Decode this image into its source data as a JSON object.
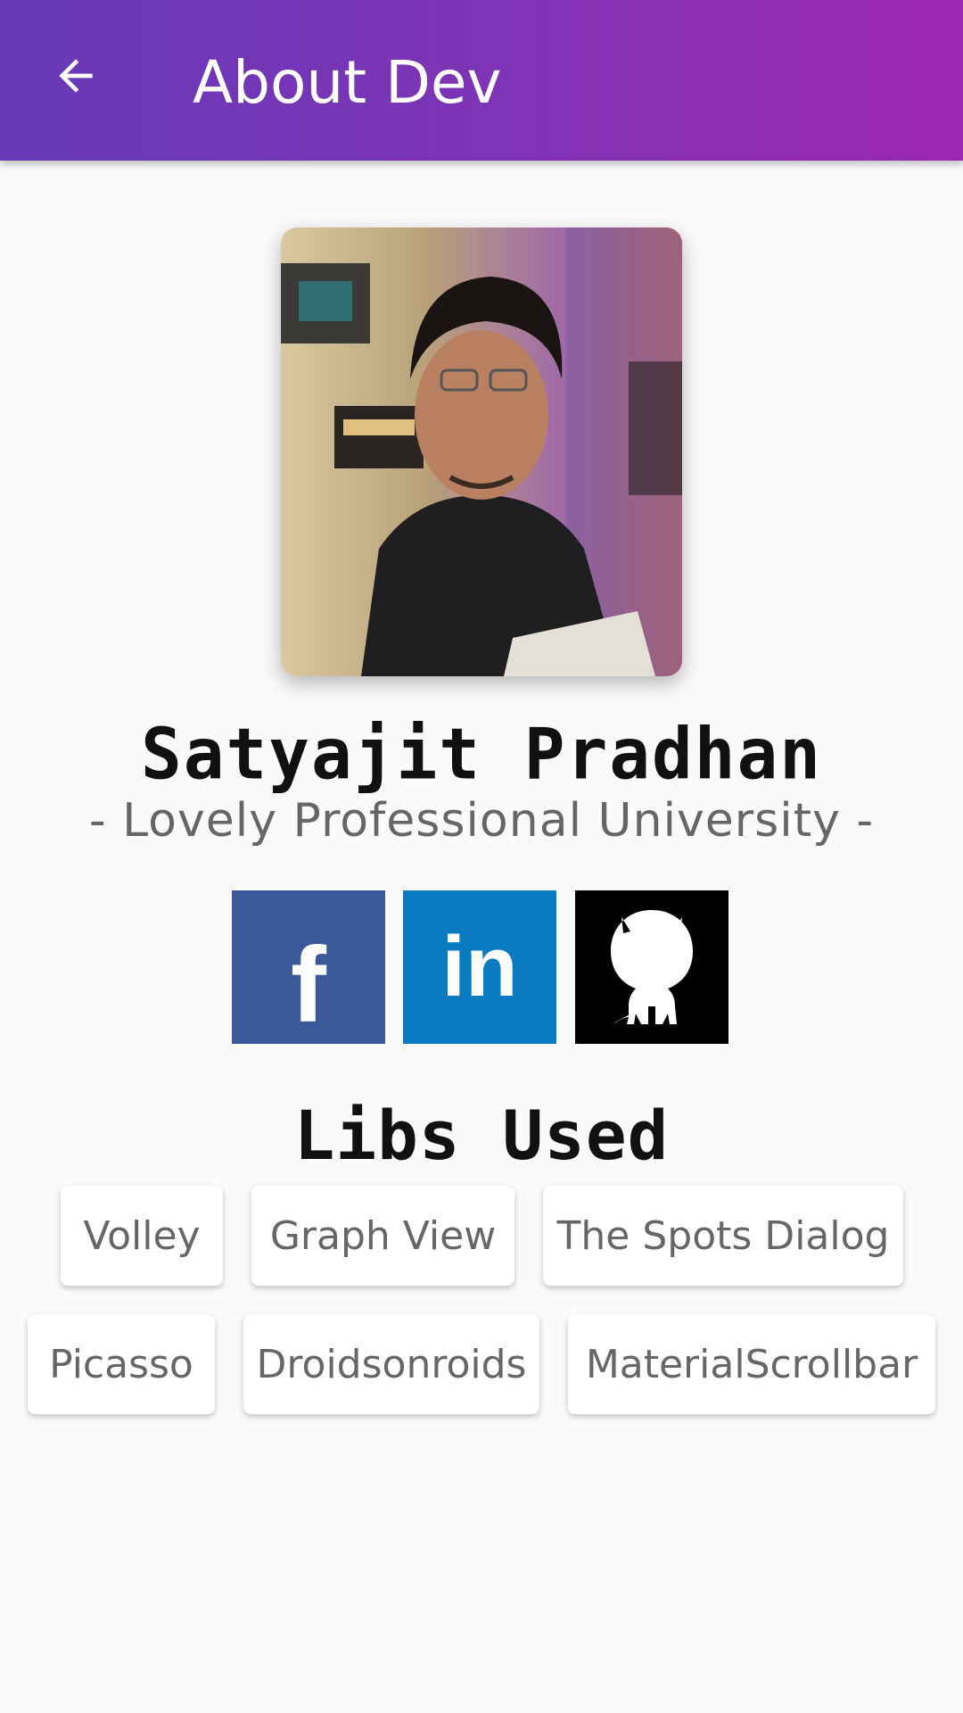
{
  "appbar": {
    "title": "About Dev",
    "back_icon": "arrow-left-icon",
    "gradient": [
      "#673ab7",
      "#9c27b0"
    ]
  },
  "profile": {
    "name": "Satyajit Pradhan",
    "university": "- Lovely Professional University -"
  },
  "social": [
    {
      "name": "facebook",
      "icon": "facebook-icon",
      "glyph": "f",
      "color": "#3b5998"
    },
    {
      "name": "linkedin",
      "icon": "linkedin-icon",
      "glyph": "in",
      "color": "#0a7bc1"
    },
    {
      "name": "github",
      "icon": "github-icon",
      "color": "#000000"
    }
  ],
  "libs": {
    "title": "Libs Used",
    "items": [
      "Volley",
      "Graph View",
      "The Spots Dialog",
      "Picasso",
      "Droidsonroids",
      "MaterialScrollbar"
    ]
  }
}
